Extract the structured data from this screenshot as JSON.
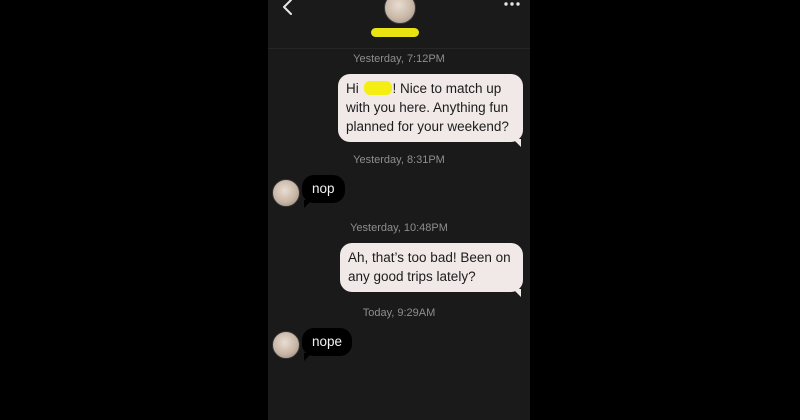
{
  "header": {
    "back_icon": "chevron-left-icon",
    "more_icon": "ellipsis-horizontal-icon",
    "contact_name": "",
    "redaction_color": "#f4ee12"
  },
  "conversation": {
    "messages": [
      {
        "timestamp": "Yesterday, 7:12PM",
        "direction": "outgoing",
        "text_before_redaction": "Hi ",
        "text_after_redaction": "! Nice to match up with you here. Anything fun planned for your weekend?"
      },
      {
        "timestamp": "Yesterday, 8:31PM",
        "direction": "incoming",
        "text": "nop"
      },
      {
        "timestamp": "Yesterday, 10:48PM",
        "direction": "outgoing",
        "text": "Ah, that’s too bad! Been on any good trips lately?"
      },
      {
        "timestamp": "Today, 9:29AM",
        "direction": "incoming",
        "text": "nope"
      }
    ]
  },
  "colors": {
    "background": "#1a1a1a",
    "outgoing_bubble": "#f1e8e8",
    "incoming_bubble": "#000000",
    "timestamp_text": "#8e8e8e"
  }
}
